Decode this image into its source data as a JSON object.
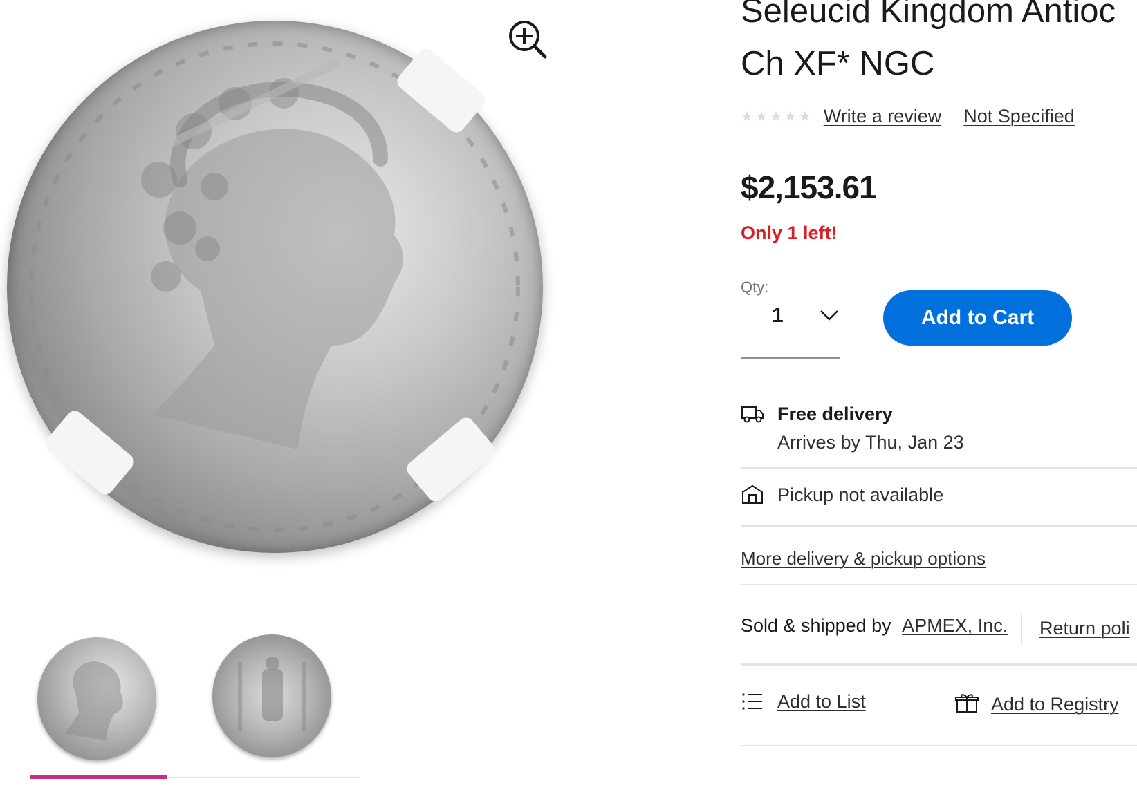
{
  "product": {
    "title_line1": "Seleucid Kingdom Antioc",
    "title_line2": "Ch XF* NGC",
    "rating_stars": 0,
    "rating_max": 5,
    "write_review_label": "Write a review",
    "spec_label": "Not Specified",
    "price": "$2,153.61",
    "stock_message": "Only 1 left!"
  },
  "gallery": {
    "zoom_icon": "zoom-in-icon",
    "thumbnails": [
      "obverse",
      "reverse"
    ],
    "active_index": 0
  },
  "purchase": {
    "qty_label": "Qty:",
    "qty_value": "1",
    "add_to_cart_label": "Add to Cart",
    "accent_color": "#0071dc"
  },
  "fulfillment": {
    "delivery_title": "Free delivery",
    "delivery_date": "Arrives by Thu, Jan 23",
    "pickup_text": "Pickup not available",
    "more_options_label": "More delivery & pickup options"
  },
  "seller": {
    "sold_by_label": "Sold & shipped by",
    "seller_name": "APMEX, Inc.",
    "return_policy_label": "Return poli"
  },
  "actions": {
    "add_to_list_label": "Add to List",
    "add_to_registry_label": "Add to Registry"
  },
  "colors": {
    "stock_red": "#de1c24",
    "active_thumb": "#c3308c",
    "star_empty": "#dadcdf"
  }
}
